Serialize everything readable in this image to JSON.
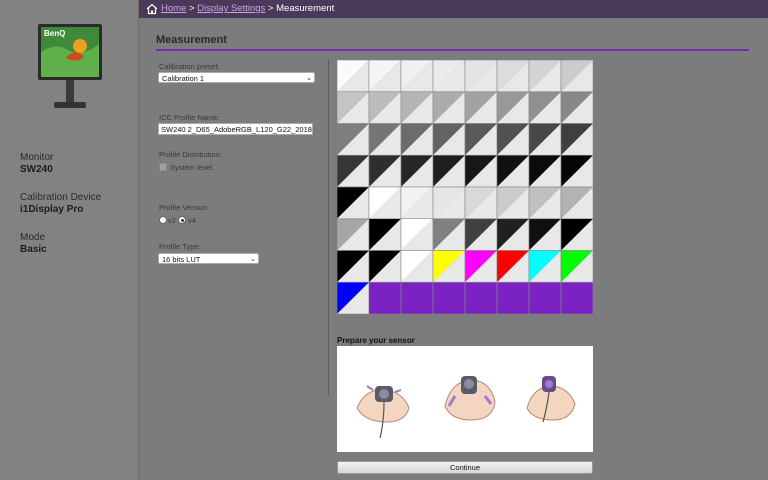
{
  "sidebar": {
    "monitor_label": "Monitor",
    "monitor_value": "SW240",
    "device_label": "Calibration Device",
    "device_value": "i1Display Pro",
    "mode_label": "Mode",
    "mode_value": "Basic",
    "brand": "BenQ"
  },
  "breadcrumb": {
    "home": "Home",
    "sep1": " > ",
    "display_settings": "Display Settings",
    "sep2": " > ",
    "current": "Measurement"
  },
  "section_title": "Measurement",
  "form": {
    "preset_label": "Calibration preset:",
    "preset_value": "Calibration 1",
    "icc_label": "ICC Profile Name:",
    "icc_value": "SW240 2_D65_AdobeRGB_L120_G22_2018-",
    "distribution_label": "Profile Distribution:",
    "system_level_label": "System level",
    "version_label": "Profile Version:",
    "v2_label": "v2",
    "v4_label": "v4",
    "type_label": "Profile Type:",
    "type_value": "16 bits LUT"
  },
  "patches": [
    [
      "#fafafa",
      "#f5f5f5",
      "#f0f0f0",
      "#ebebeb",
      "#e4e4e4",
      "#dcdcdc",
      "#d4d4d4",
      "#cccccc"
    ],
    [
      "#c4c4c4",
      "#bcbcbc",
      "#b4b4b4",
      "#ababab",
      "#a2a2a2",
      "#999999",
      "#909090",
      "#878787"
    ],
    [
      "#7e7e7e",
      "#757575",
      "#6c6c6c",
      "#636363",
      "#5a5a5a",
      "#515151",
      "#484848",
      "#3f3f3f"
    ],
    [
      "#363636",
      "#2e2e2e",
      "#262626",
      "#1e1e1e",
      "#171717",
      "#111111",
      "#0b0b0b",
      "#050505"
    ],
    [
      "#000000",
      "#ffffff",
      "#f2f2f2",
      "#e6e6e6",
      "#d9d9d9",
      "#cccccc",
      "#bfbfbf",
      "#b3b3b3"
    ],
    [
      "#a6a6a6",
      "#000000",
      "#ffffff",
      "#808080",
      "#404040",
      "#202020",
      "#101010",
      "#000000"
    ],
    [
      "#000000",
      "#000000",
      "#ffffff",
      "#ffff00",
      "#ff00ff",
      "#ff0000",
      "#00ffff",
      "#00ff00"
    ],
    [
      "#0000ff",
      "#7a22c2",
      "#7a22c2",
      "#7a22c2",
      "#7a22c2",
      "#7a22c2",
      "#7a22c2",
      "#7a22c2"
    ]
  ],
  "prepare_title": "Prepare your sensor",
  "continue_label": "Continue"
}
